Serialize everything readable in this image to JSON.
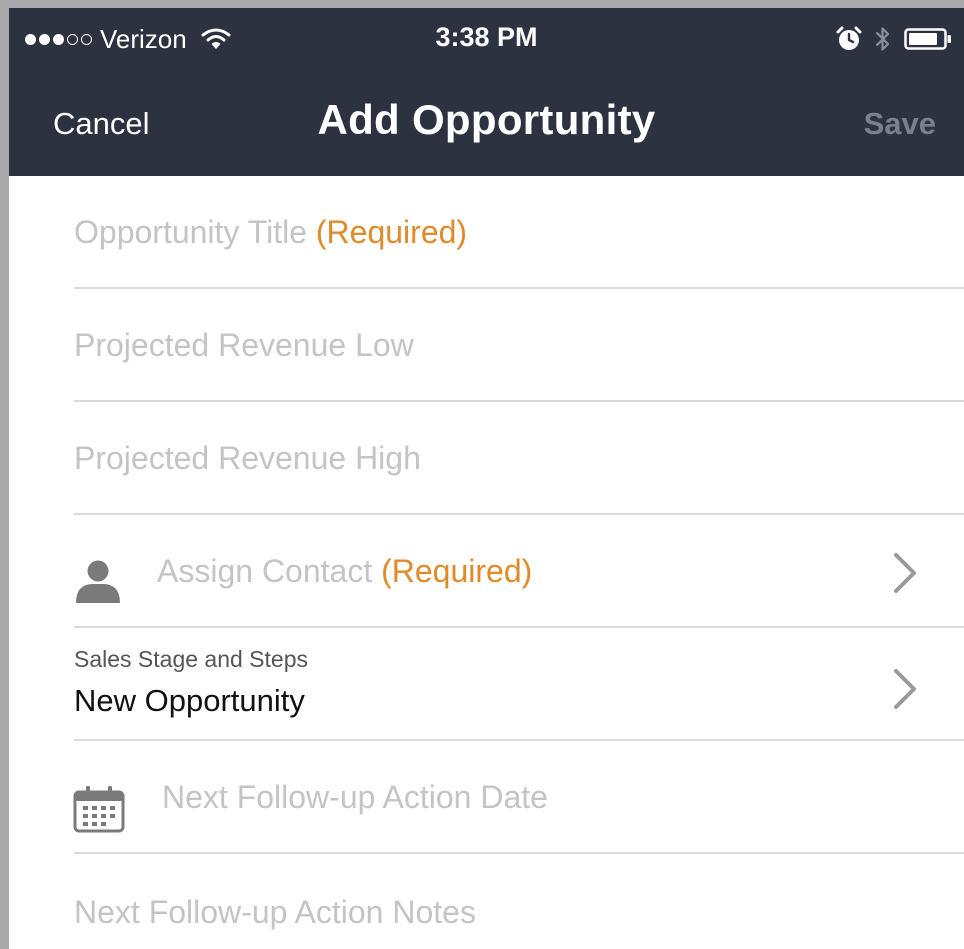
{
  "status_bar": {
    "carrier": "Verizon",
    "time": "3:38 PM",
    "signal_bars_filled": 3,
    "signal_bars_total": 5,
    "icons": [
      "wifi-icon",
      "alarm-icon",
      "bluetooth-icon",
      "battery-icon"
    ]
  },
  "nav": {
    "cancel_label": "Cancel",
    "title": "Add Opportunity",
    "save_label": "Save"
  },
  "form": {
    "opportunity_title": {
      "placeholder": "Opportunity Title",
      "required_label": "(Required)"
    },
    "revenue_low": {
      "placeholder": "Projected Revenue Low"
    },
    "revenue_high": {
      "placeholder": "Projected Revenue High"
    },
    "assign_contact": {
      "placeholder": "Assign Contact",
      "required_label": "(Required)",
      "icon": "person-icon"
    },
    "sales_stage": {
      "label": "Sales Stage and Steps",
      "value": "New Opportunity"
    },
    "followup_date": {
      "placeholder": "Next Follow-up Action Date",
      "icon": "calendar-icon"
    },
    "followup_notes": {
      "placeholder": "Next Follow-up Action Notes"
    }
  },
  "colors": {
    "header_bg": "#2d3241",
    "required": "#e38a28",
    "placeholder": "#c4c4c4",
    "save_disabled": "#7c808b",
    "divider": "#dadada"
  }
}
